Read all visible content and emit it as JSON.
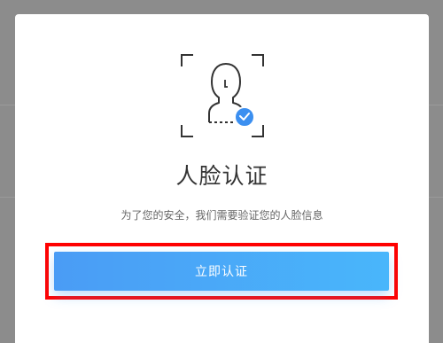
{
  "dialog": {
    "title": "人脸认证",
    "subtitle": "为了您的安全，我们需要验证您的人脸信息",
    "verify_button_label": "立即认证"
  },
  "icons": {
    "face": "face-scan-icon",
    "check": "check-badge-icon"
  },
  "colors": {
    "button_gradient_start": "#4a9cf5",
    "button_gradient_end": "#49b6fb",
    "check_badge": "#3b8ff0",
    "highlight_border": "#ff0000",
    "overlay": "#8c8c8c"
  }
}
